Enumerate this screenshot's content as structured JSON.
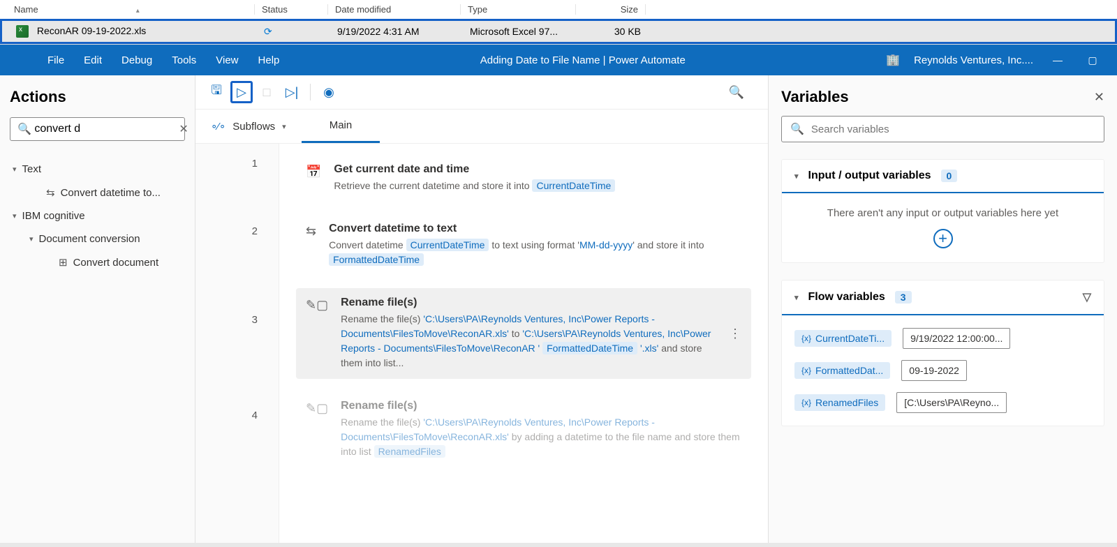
{
  "explorer": {
    "columns": {
      "name": "Name",
      "status": "Status",
      "date": "Date modified",
      "type": "Type",
      "size": "Size"
    },
    "row": {
      "name": "ReconAR 09-19-2022.xls",
      "status_icon": "sync",
      "date": "9/19/2022 4:31 AM",
      "type": "Microsoft Excel 97...",
      "size": "30 KB"
    }
  },
  "titlebar": {
    "menus": [
      "File",
      "Edit",
      "Debug",
      "Tools",
      "View",
      "Help"
    ],
    "title": "Adding Date to File Name | Power Automate",
    "org": "Reynolds Ventures, Inc...."
  },
  "actions": {
    "heading": "Actions",
    "search_value": "convert d",
    "tree": {
      "text": "Text",
      "convert_datetime": "Convert datetime to...",
      "ibm": "IBM cognitive",
      "doc_conv": "Document conversion",
      "convert_doc": "Convert document"
    }
  },
  "designer": {
    "subflows_label": "Subflows",
    "tab_main": "Main",
    "steps": [
      {
        "num": "1",
        "title": "Get current date and time",
        "desc_pre": "Retrieve the current datetime and store it into ",
        "var1": "CurrentDateTime"
      },
      {
        "num": "2",
        "title": "Convert datetime to text",
        "desc_pre": "Convert datetime ",
        "var1": "CurrentDateTime",
        "desc_mid": " to text using format '",
        "fmt": "MM-dd-yyyy",
        "desc_mid2": "' and store it into ",
        "var2": "FormattedDateTime"
      },
      {
        "num": "3",
        "title": "Rename file(s)",
        "desc_pre": "Rename the file(s) ",
        "path1": "'C:\\Users\\PA\\Reynolds Ventures, Inc\\Power Reports - Documents\\FilesToMove\\ReconAR.xls'",
        "desc_mid": " to ",
        "path2": "'C:\\Users\\PA\\Reynolds Ventures, Inc\\Power Reports - Documents\\FilesToMove\\ReconAR '",
        "var1": "FormattedDateTime",
        "ext": " '.xls'",
        "desc_end": " and store them into list..."
      },
      {
        "num": "4",
        "title": "Rename file(s)",
        "desc_pre": "Rename the file(s) ",
        "path1": "'C:\\Users\\PA\\Reynolds Ventures, Inc\\Power Reports - Documents\\FilesToMove\\ReconAR.xls'",
        "desc_mid": " by adding a datetime to the file name and store them into list ",
        "var1": "RenamedFiles"
      }
    ]
  },
  "vars": {
    "heading": "Variables",
    "search_placeholder": "Search variables",
    "io_section": "Input / output variables",
    "io_count": "0",
    "io_empty": "There aren't any input or output variables here yet",
    "flow_section": "Flow variables",
    "flow_count": "3",
    "items": [
      {
        "name": "CurrentDateTi...",
        "value": "9/19/2022 12:00:00..."
      },
      {
        "name": "FormattedDat...",
        "value": "09-19-2022"
      },
      {
        "name": "RenamedFiles",
        "value": "[C:\\Users\\PA\\Reyno..."
      }
    ]
  }
}
